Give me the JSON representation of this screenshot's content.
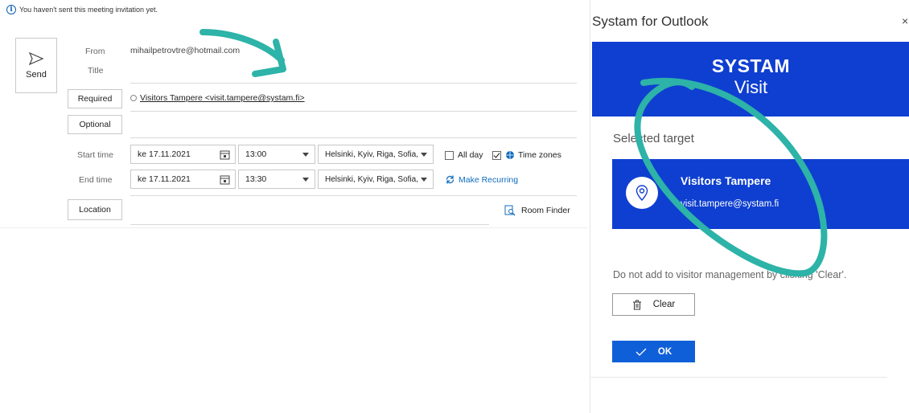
{
  "info": {
    "text": "You haven't sent this meeting invitation yet."
  },
  "send": {
    "label": "Send"
  },
  "form": {
    "from_label": "From",
    "from_value": "mihailpetrovtre@hotmail.com",
    "title_label": "Title",
    "required_label": "Required",
    "required_value": "Visitors Tampere <visit.tampere@systam.fi>",
    "optional_label": "Optional",
    "start_label": "Start time",
    "start_date": "ke 17.11.2021",
    "start_time": "13:00",
    "start_tz": "Helsinki, Kyiv, Riga, Sofia,",
    "allday_label": "All day",
    "timezones_label": "Time zones",
    "end_label": "End time",
    "end_date": "ke 17.11.2021",
    "end_time": "13:30",
    "end_tz": "Helsinki, Kyiv, Riga, Sofia,",
    "recurring_label": "Make Recurring",
    "location_label": "Location",
    "room_finder_label": "Room Finder"
  },
  "panel": {
    "title": "Systam for Outlook",
    "close": "×",
    "logo_line1": "SYSTAM",
    "logo_line2": "Visit",
    "selected_label": "Selected target",
    "target_name": "Visitors Tampere",
    "target_email": "visit.tampere@systam.fi",
    "hint": "Do not add to visitor management by clicking 'Clear'.",
    "clear_label": "Clear",
    "ok_label": "OK"
  },
  "colors": {
    "brand_blue": "#0f3fd0",
    "annotation_teal": "#2db3a8",
    "link_blue": "#0f6cbd"
  },
  "checkboxes": {
    "all_day": false,
    "time_zones": true
  }
}
